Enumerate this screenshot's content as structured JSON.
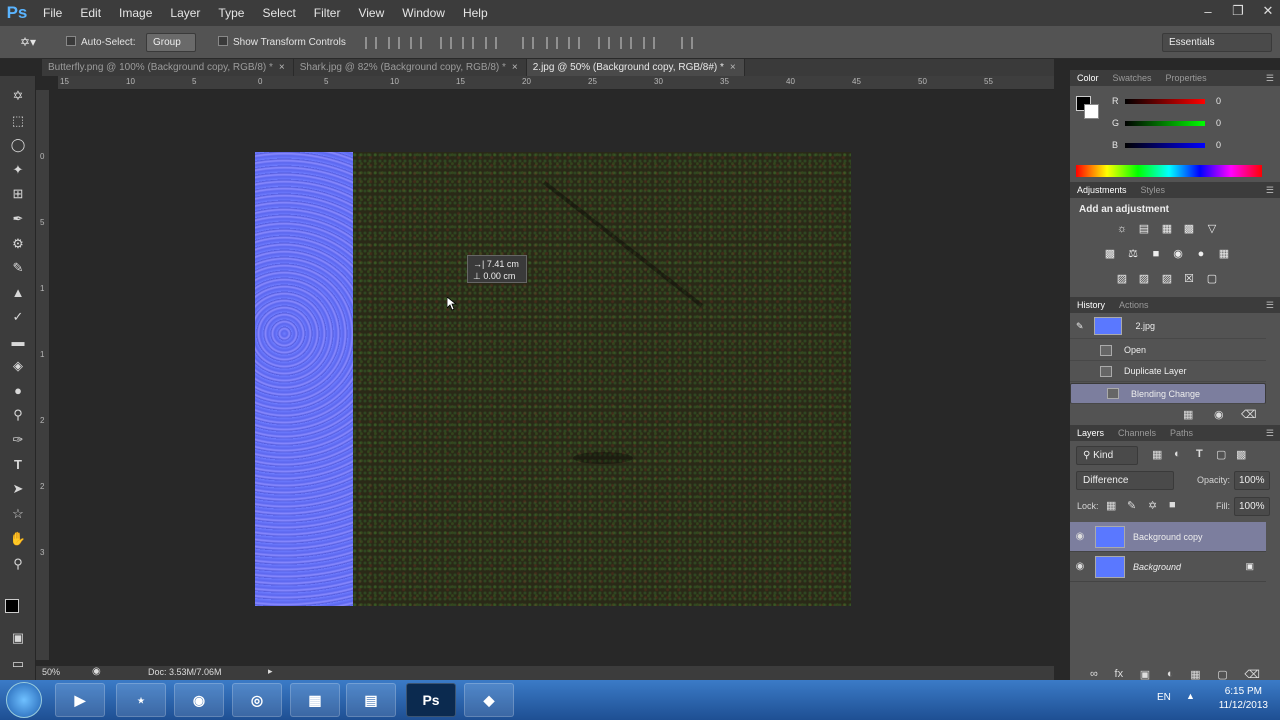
{
  "app": {
    "logo": "Ps",
    "menus": [
      "File",
      "Edit",
      "Image",
      "Layer",
      "Type",
      "Select",
      "Filter",
      "View",
      "Window",
      "Help"
    ],
    "window_controls": [
      "–",
      "❐",
      "✕"
    ]
  },
  "options": {
    "auto_select": "Auto-Select:",
    "group": "Group",
    "show_transform": "Show Transform Controls",
    "workspace": "Essentials"
  },
  "tabs": [
    {
      "label": "Butterfly.png @ 100% (Background copy, RGB/8) *",
      "close": "×"
    },
    {
      "label": "Shark.jpg @ 82% (Background copy, RGB/8) *",
      "close": "×"
    },
    {
      "label": "2.jpg @ 50% (Background copy, RGB/8#) *",
      "close": "×"
    }
  ],
  "ruler": {
    "h": [
      "15",
      "10",
      "5",
      "0",
      "5",
      "10",
      "15",
      "20",
      "25",
      "30",
      "35",
      "40",
      "45",
      "50",
      "55"
    ],
    "v": [
      "0",
      "5",
      "1",
      "1",
      "2",
      "2",
      "3"
    ]
  },
  "measure": {
    "dx": "→| 7.41 cm",
    "dy": "⊥ 0.00 cm"
  },
  "status": {
    "zoom": "50%",
    "doc": "Doc: 3.53M/7.06M"
  },
  "color_panel": {
    "tabs": [
      "Color",
      "Swatches",
      "Properties"
    ],
    "r_label": "R",
    "g_label": "G",
    "b_label": "B",
    "r": "0",
    "g": "0",
    "b": "0",
    "colors": {
      "fg": "#000000",
      "bg": "#ffffff"
    }
  },
  "adjustments": {
    "tabs": [
      "Adjustments",
      "Styles"
    ],
    "title": "Add an adjustment"
  },
  "history": {
    "tabs": [
      "History",
      "Actions"
    ],
    "snapshot": "2.jpg",
    "items": [
      "Open",
      "Duplicate Layer",
      "Blending Change"
    ]
  },
  "layers": {
    "tabs": [
      "Layers",
      "Channels",
      "Paths"
    ],
    "kind": "Kind",
    "blend_mode": "Difference",
    "opacity_label": "Opacity:",
    "opacity": "100%",
    "lock_label": "Lock:",
    "fill_label": "Fill:",
    "fill": "100%",
    "items": [
      "Background copy",
      "Background"
    ]
  },
  "taskbar": {
    "lang": "EN",
    "time": "6:15 PM",
    "date": "11/12/2013",
    "apps": [
      "Ps"
    ]
  }
}
